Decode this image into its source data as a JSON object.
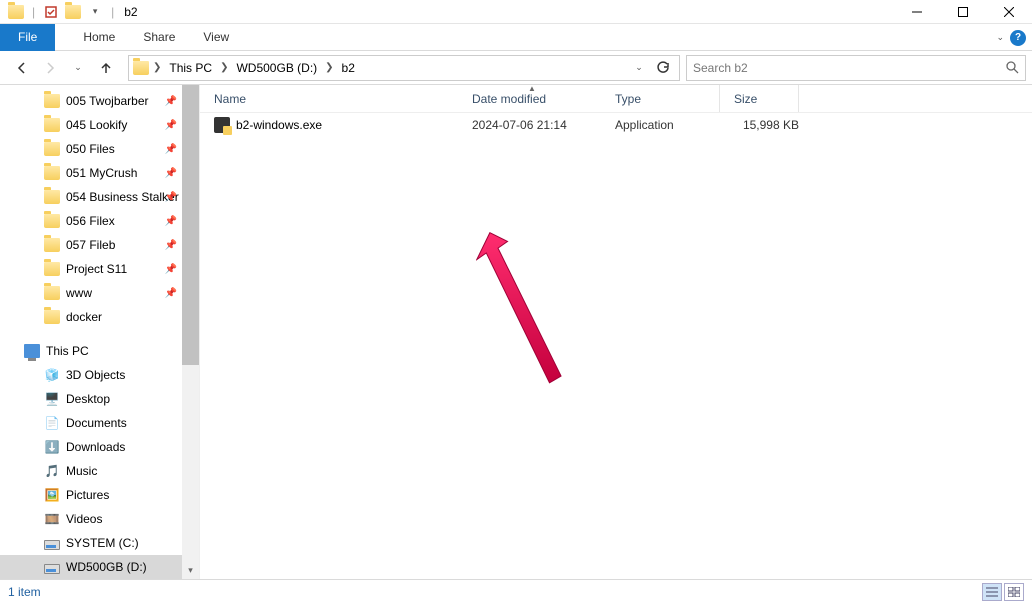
{
  "title": "b2",
  "menu": {
    "file": "File",
    "tabs": [
      "Home",
      "Share",
      "View"
    ]
  },
  "breadcrumb": {
    "segments": [
      "This PC",
      "WD500GB (D:)",
      "b2"
    ]
  },
  "search": {
    "placeholder": "Search b2"
  },
  "columns": {
    "name": "Name",
    "date": "Date modified",
    "type": "Type",
    "size": "Size"
  },
  "files": [
    {
      "name": "b2-windows.exe",
      "date": "2024-07-06 21:14",
      "type": "Application",
      "size": "15,998 KB"
    }
  ],
  "sidebar": {
    "pinned": [
      "005 Twojbarber",
      "045 Lookify",
      "050 Files",
      "051 MyCrush",
      "054 Business Stalker",
      "056 Filex",
      "057 Fileb",
      "Project S11",
      "www",
      "docker"
    ],
    "this_pc": "This PC",
    "pc_items": [
      "3D Objects",
      "Desktop",
      "Documents",
      "Downloads",
      "Music",
      "Pictures",
      "Videos",
      "SYSTEM (C:)",
      "WD500GB (D:)"
    ]
  },
  "status": {
    "count": "1 item"
  }
}
